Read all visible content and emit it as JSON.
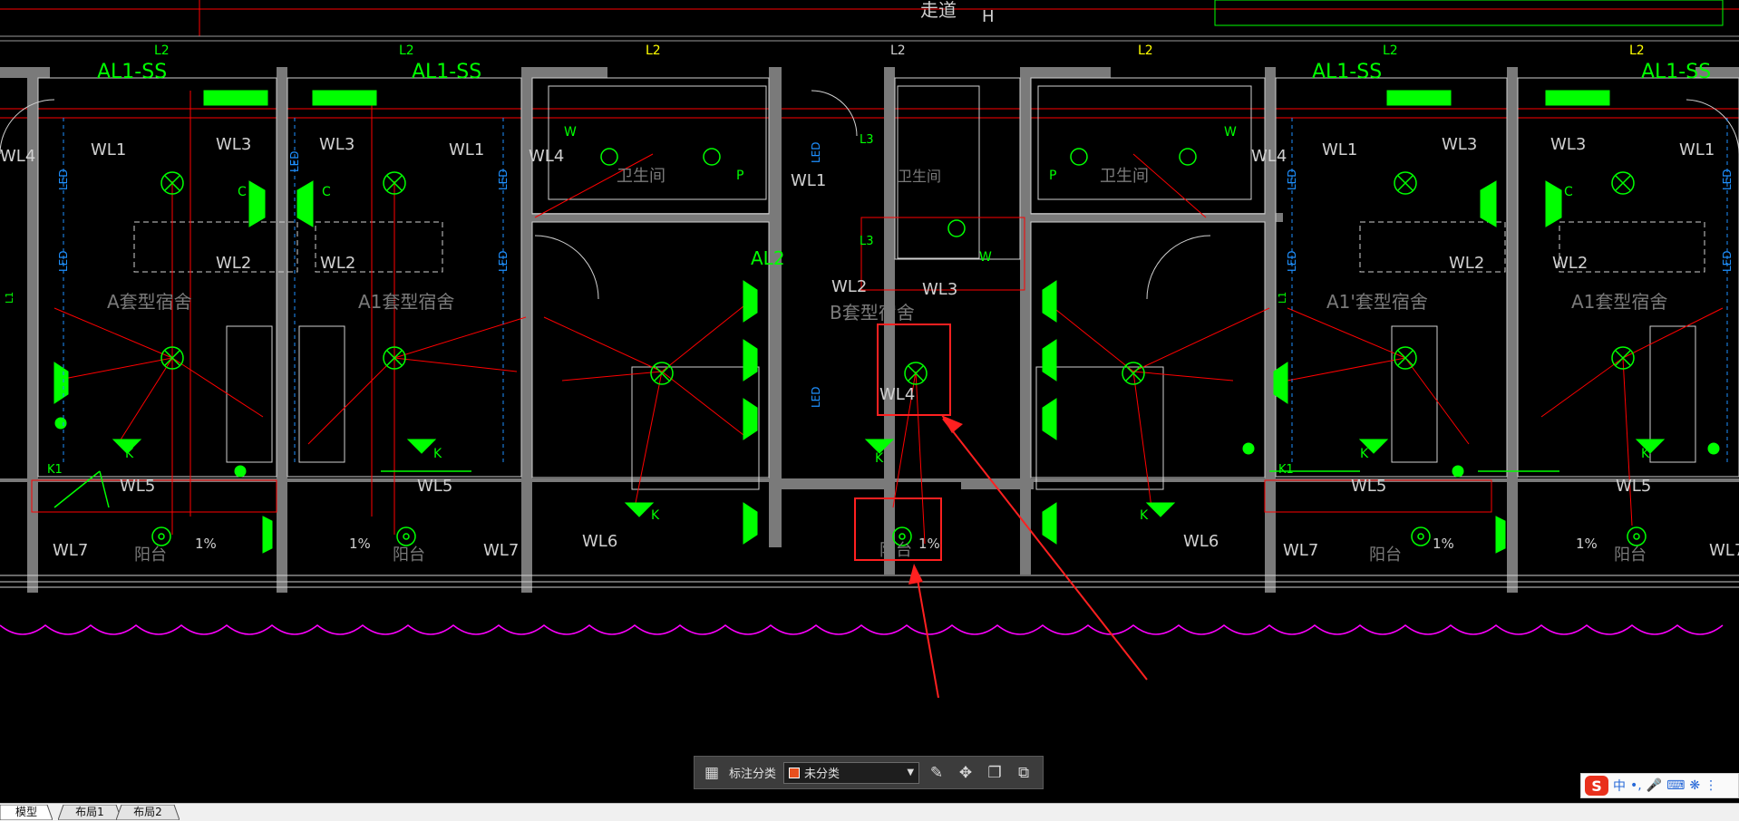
{
  "drawing": {
    "top_labels": {
      "corridor": "走道",
      "h_mark": "H"
    },
    "panel_labels": [
      "AL1-SS",
      "AL1-SS",
      "AL1-SS",
      "AL1-SS"
    ],
    "panel_al2": "AL2",
    "level_marks": [
      "L2",
      "L2",
      "L2",
      "L2",
      "L2",
      "L2",
      "L2"
    ],
    "circuits": {
      "wl1": "WL1",
      "wl2": "WL2",
      "wl3": "WL3",
      "wl4": "WL4",
      "wl5": "WL5",
      "wl6": "WL6",
      "wl7": "WL7"
    },
    "rooms": {
      "a_dorm": "A套型宿舍",
      "a1_dorm": "A1套型宿舍",
      "a1p_dorm": "A1'套型宿舍",
      "b_dorm": "B套型宿舍",
      "bathroom": "卫生间",
      "balcony": "阳台"
    },
    "fixture_marks": {
      "led": "LED",
      "l1": "L1",
      "l3": "L3",
      "k": "K",
      "c": "C",
      "p": "P",
      "w": "W",
      "k1": "K1",
      "slope": "1%"
    }
  },
  "toolbar": {
    "category_label": "标注分类",
    "category_value": "未分类",
    "category_color": "#e8501e",
    "icons": [
      "grid-icon",
      "edit-icon",
      "move-icon",
      "copy-icon",
      "paste-icon"
    ]
  },
  "tabs": [
    "模型",
    "布局1",
    "布局2"
  ],
  "ime": {
    "logo": "S",
    "mode": "中"
  },
  "colors": {
    "green": "#00ff00",
    "red": "#ff0000",
    "magenta": "#ff00ff",
    "white": "#d0d0d0",
    "gray": "#9a9a9a",
    "annotation_red": "#ff2020"
  }
}
